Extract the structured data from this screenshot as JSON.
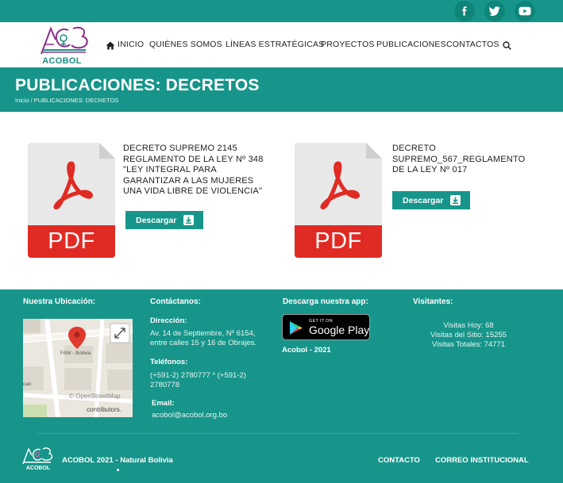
{
  "colors": {
    "teal": "#17958a",
    "pdf_red": "#e02b24",
    "brand_purple": "#8b2d8a"
  },
  "social": [
    {
      "icon": "facebook-icon"
    },
    {
      "icon": "twitter-icon"
    },
    {
      "icon": "youtube-icon"
    }
  ],
  "header": {
    "logo_text": "ACOBOL",
    "nav": [
      "INICIO",
      "QUIÉNES SOMOS",
      "LÍNEAS ESTRATÉGICAS",
      "PROYECTOS",
      "PUBLICACIONES",
      "CONTACTOS"
    ]
  },
  "title_band": {
    "title": "PUBLICACIONES: DECRETOS",
    "breadcrumb": "Inicio / PUBLICACIONES: DECRETOS"
  },
  "documents": [
    {
      "title": "DECRETO SUPREMO 2145 REGLAMENTO DE LA LEY Nº 348 \"LEY INTEGRAL PARA GARANTIZAR A LAS MUJERES UNA VIDA LIBRE DE VIOLENCIA\"",
      "badge": "PDF",
      "button": "Descargar"
    },
    {
      "title": "DECRETO SUPREMO_567_REGLAMENTO DE LA LEY Nº 017",
      "badge": "PDF",
      "button": "Descargar"
    }
  ],
  "footer": {
    "location_heading": "Nuestra Ubicación:",
    "map": {
      "place_label": "FAM - Bolivia",
      "attribution_1": "© OpenStreetMap",
      "attribution_2": "contributors.",
      "partial_label": "can"
    },
    "contact_heading": "Contáctanos:",
    "address_label": "Dirección:",
    "address": "Av. 14 de Septiembre, Nº 6154, entre calles 15 y 16 de Obrajes.",
    "phones_label": "Teléfonos:",
    "phones": "(+591-2) 2780777 * (+591-2) 2780778",
    "email_label": "Email:",
    "email": "acobol@acobol.org.bo",
    "app_heading": "Descarga nuestra app:",
    "gplay_small": "GET IT ON",
    "gplay_big": "Google Play",
    "app_caption": "Acobol - 2021",
    "visitors_heading": "Visitantes:",
    "visits_today": "Visitas Hoy: 68",
    "visits_site": "Visitas del Sitio: 15255",
    "visits_total": "Visitas Totales: 74771",
    "logo_text": "ACOBOL",
    "copyright": "ACOBOL 2021 - Natural Bolivia",
    "links": [
      "CONTACTO",
      "CORREO INSTITUCIONAL"
    ]
  }
}
